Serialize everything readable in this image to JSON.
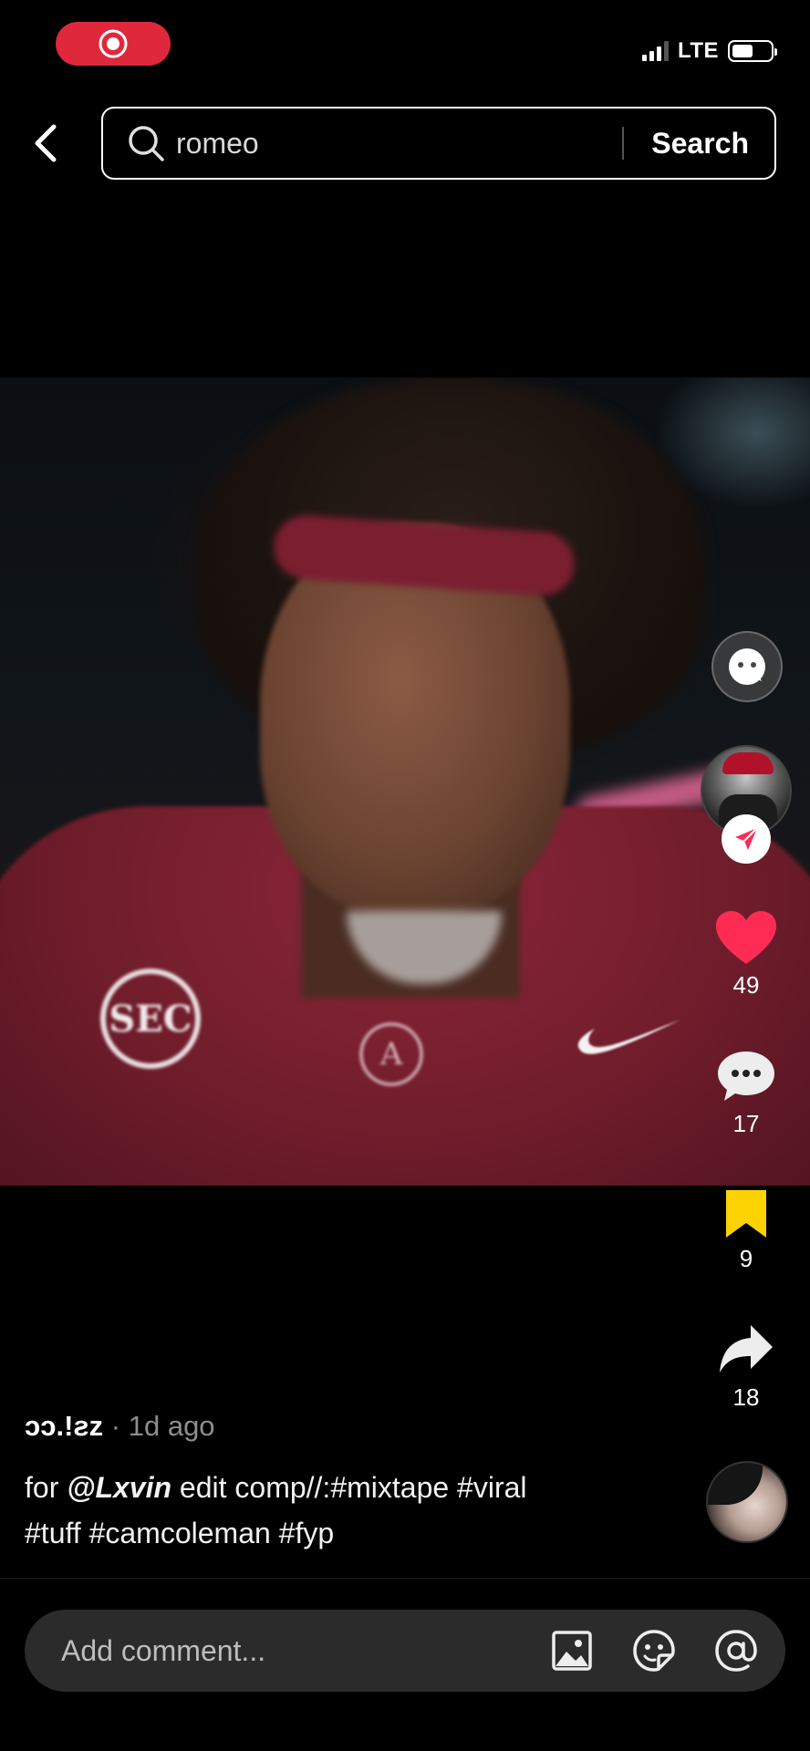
{
  "status_bar": {
    "network": "LTE",
    "recording_icon": "record-icon",
    "battery_level": 0.55
  },
  "search": {
    "query": "romeo",
    "button_label": "Search",
    "back_icon": "chevron-left-icon",
    "search_icon": "search-icon"
  },
  "actions": {
    "likes": "49",
    "comments": "17",
    "saves": "9",
    "shares": "18"
  },
  "post": {
    "author": "ɔɔ.!ƨz",
    "age": "· 1d ago",
    "caption_prefix": "for ",
    "mention": "@Lxvin",
    "caption_rest": " edit comp//:#mixtape #viral",
    "caption_line2": "#tuff #camcoleman #fyp"
  },
  "video_overlay": {
    "patch_text": "SEC",
    "logo_letter": "A"
  },
  "comment_bar": {
    "placeholder": "Add comment..."
  },
  "colors": {
    "accent_red": "#e0283c",
    "like_red": "#fe2c55",
    "save_yellow": "#fcd200",
    "comment_bar_bg": "#2b2b2b"
  }
}
